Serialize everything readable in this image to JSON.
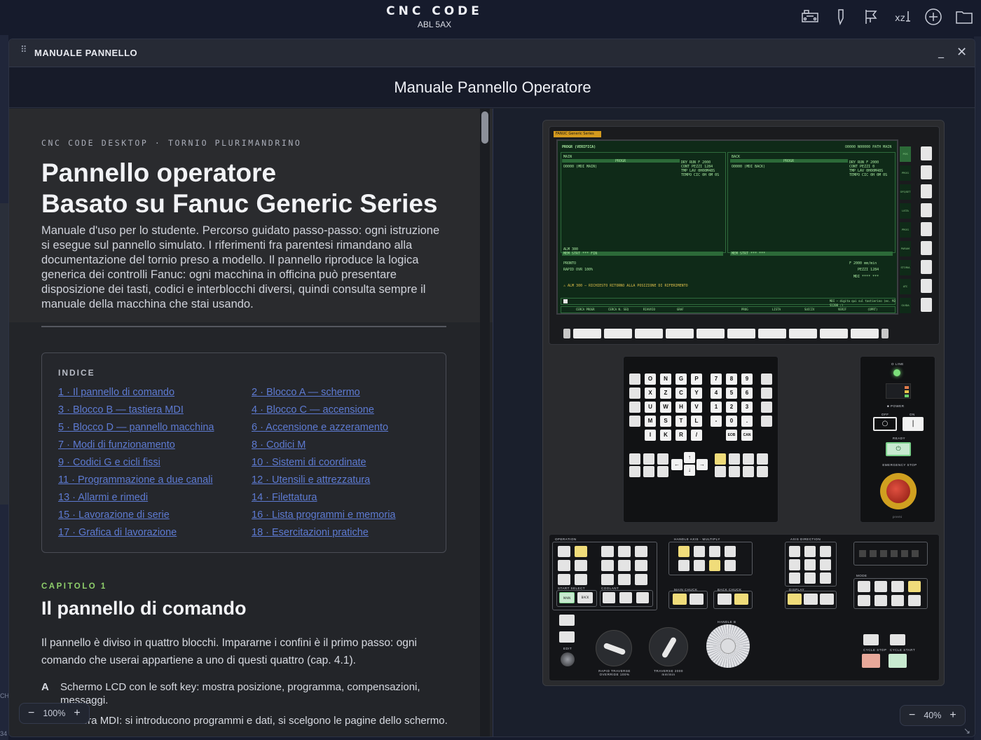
{
  "app": {
    "title": "CNC CODE",
    "subtitle": "ABL 5AX",
    "toolbar_icons": [
      "machine-icon",
      "tool-icon",
      "flag-icon",
      "axis-icon",
      "add-circle-icon",
      "folder-icon"
    ]
  },
  "edge": {
    "ch": "CH",
    "num": "34"
  },
  "window": {
    "title": "MANUALE PANNELLO",
    "header": "Manuale Pannello Operatore"
  },
  "doc": {
    "eyebrow": "CNC CODE DESKTOP · TORNIO PLURIMANDRINO",
    "title_line1": "Pannello operatore",
    "title_line2": "Basato su Fanuc Generic Series",
    "lede": "Manuale d'uso per lo studente. Percorso guidato passo-passo: ogni istruzione si esegue sul pannello simulato. I riferimenti fra parentesi rimandano alla documentazione del tornio preso a modello. Il pannello riproduce la logica generica dei controlli Fanuc: ogni macchina in officina può presentare disposizione dei tasti, codici e interblocchi diversi, quindi consulta sempre il manuale della macchina che stai usando.",
    "toc_heading": "INDICE",
    "toc": [
      "1 · Il pannello di comando",
      "2 · Blocco A — schermo",
      "3 · Blocco B — tastiera MDI",
      "4 · Blocco C — accensione",
      "5 · Blocco D — pannello macchina",
      "6 · Accensione e azzeramento",
      "7 · Modi di funzionamento",
      "8 · Codici M",
      "9 · Codici G e cicli fissi",
      "10 · Sistemi di coordinate",
      "11 · Programmazione a due canali",
      "12 · Utensili e attrezzatura",
      "13 · Allarmi e rimedi",
      "14 · Filettatura",
      "15 · Lavorazione di serie",
      "16 · Lista programmi e memoria",
      "17 · Grafica di lavorazione",
      "18 · Esercitazioni pratiche"
    ],
    "chapter_kicker": "CAPITOLO 1",
    "chapter_title": "Il pannello di comando",
    "paragraph": "Il pannello è diviso in quattro blocchi. Impararne i confini è il primo passo: ogni comando che userai appartiene a uno di questi quattro (cap. 4.1).",
    "items": [
      {
        "letter": "A",
        "text": "Schermo LCD con le soft key: mostra posizione, programma, compensazioni, messaggi."
      },
      {
        "letter": "B",
        "text": "Tastiera MDI: si introducono programmi e dati, si scelgono le pagine dello schermo."
      }
    ],
    "zoom": "100%"
  },
  "panel": {
    "zoom": "40%",
    "lcd": {
      "brand": "FANUC Generic Series",
      "title": "PROGR (VERIFICA)",
      "prog": "O0000 N00000 PATH MAIN",
      "main": "MAIN",
      "back": "BACK",
      "progr": "PROGR",
      "main_prog": "O0000 (MDI MAIN)",
      "back_prog": "O0000 (MDI BACK)",
      "stats_left": [
        "DRY RUN F 2000",
        "CONT PEZZI 1284",
        "TMP LAV 0H00M48S",
        "TEMPO CIC 0H 0M 0S"
      ],
      "stats_right": [
        "DRY RUN F 2000",
        "CONT PEZZI 0",
        "TMP LAV 0H00M48S",
        "TEMPO CIC 0H 0M 0S"
      ],
      "alm": "ALM 300",
      "mem_left": "MEM STRT *** FIN",
      "mem_right": "MEM STRT *** ***",
      "status": "PRONTO",
      "rapid": "RAPID OVR 100%",
      "feed": "F 2000 mm/min",
      "pezzi": "PEZZI 1284",
      "mdi": "MDI **** ***",
      "alarm": "⚠ ALM 300 — RICHIESTO RITORNO ALLA POSIZIONE DI RIFERIMENTO",
      "input_hint": "MDI — digita qui sul tastierino (es. M3 S1200 ;)",
      "softkeys": [
        "CERCA PROGR",
        "CERCA N. SEQ",
        "RIAVVIO",
        "GRAF",
        "",
        "PROG",
        "LISTA",
        "SUCCIV",
        "VERIF",
        "(OPRT)"
      ],
      "side_labels": [
        "POS",
        "PROG",
        "OFS/SET",
        "LISTA PROGR",
        "PROG",
        "PARAM",
        "STORIA",
        "ATC",
        "GUIDA"
      ]
    },
    "mdi_keys": [
      "O",
      "N",
      "G",
      "P",
      "7",
      "8",
      "9",
      "X",
      "Z",
      "C",
      "Y",
      "4",
      "5",
      "6",
      "U",
      "W",
      "H",
      "V",
      "1",
      "2",
      "3",
      "M",
      "S",
      "T",
      "L",
      "-",
      "0",
      ".",
      "I",
      "K",
      "R",
      "/",
      "EOB",
      "CAN"
    ],
    "power": {
      "line": "O LINE",
      "power": "■ POWER",
      "off": "OFF",
      "on": "ON",
      "ready": "READY",
      "estop": "EMERGENCY STOP",
      "push": "premi"
    },
    "ctrl_labels": {
      "operation": "OPERATION",
      "handle_axis": "HANDLE AXIS · MULTIPLY",
      "axis_direction": "AXIS DIRECTION",
      "mode": "MODE",
      "start_select": "START SELECT",
      "coolant": "COOLANT",
      "main_chuck": "MAIN CHUCK",
      "back_chuck": "BACK CHUCK",
      "display": "DISPLAY",
      "rapid_override": "RAPID TRAVERSE OVERRIDE 100%",
      "traverse": "TRAVERSE 2000 mm/min",
      "handle": "HANDLE B",
      "edit": "EDIT",
      "cycle_stop": "CYCLE STOP",
      "cycle_start": "CYCLE START",
      "main": "MAIN",
      "back": "BACK"
    }
  }
}
